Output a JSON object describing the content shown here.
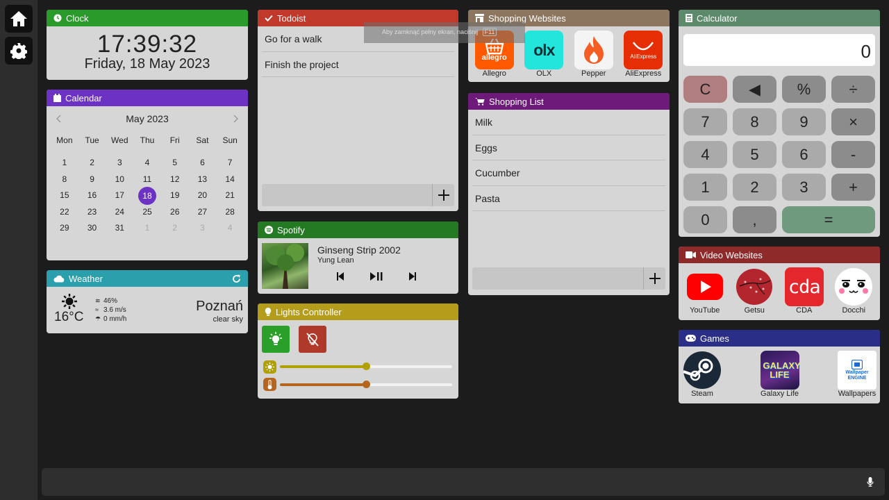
{
  "clock": {
    "title": "Clock",
    "time": "17:39:32",
    "date": "Friday, 18 May 2023",
    "color": "#2a9a2a"
  },
  "calendar": {
    "title": "Calendar",
    "month": "May 2023",
    "color": "#6c32c4",
    "weekdays": [
      "Mon",
      "Tue",
      "Wed",
      "Thu",
      "Fri",
      "Sat",
      "Sun"
    ],
    "days": [
      {
        "d": "1"
      },
      {
        "d": "2"
      },
      {
        "d": "3"
      },
      {
        "d": "4"
      },
      {
        "d": "5"
      },
      {
        "d": "6"
      },
      {
        "d": "7"
      },
      {
        "d": "8"
      },
      {
        "d": "9"
      },
      {
        "d": "10"
      },
      {
        "d": "11"
      },
      {
        "d": "12"
      },
      {
        "d": "13"
      },
      {
        "d": "14"
      },
      {
        "d": "15"
      },
      {
        "d": "16"
      },
      {
        "d": "17"
      },
      {
        "d": "18",
        "selected": true
      },
      {
        "d": "19"
      },
      {
        "d": "20"
      },
      {
        "d": "21"
      },
      {
        "d": "22"
      },
      {
        "d": "23"
      },
      {
        "d": "24"
      },
      {
        "d": "25"
      },
      {
        "d": "26"
      },
      {
        "d": "27"
      },
      {
        "d": "28"
      },
      {
        "d": "29"
      },
      {
        "d": "30"
      },
      {
        "d": "31"
      },
      {
        "d": "1",
        "other": true
      },
      {
        "d": "2",
        "other": true
      },
      {
        "d": "3",
        "other": true
      },
      {
        "d": "4",
        "other": true
      }
    ]
  },
  "weather": {
    "title": "Weather",
    "temp": "16°C",
    "humidity": "46%",
    "wind": "3.6 m/s",
    "rain": "0 mm/h",
    "city": "Poznań",
    "desc": "clear sky",
    "color": "#2b9fab"
  },
  "todoist": {
    "title": "Todoist",
    "color": "#c0392b",
    "items": [
      "Go for a walk",
      "Finish the project"
    ]
  },
  "spotify": {
    "title": "Spotify",
    "color": "#237a23",
    "track": "Ginseng Strip 2002",
    "artist": "Yung Lean"
  },
  "lights": {
    "title": "Lights Controller",
    "color": "#b59d1c",
    "brightness": 0.5,
    "temperature": 0.5,
    "brightness_color": "#b0a000",
    "temperature_color": "#b5651d"
  },
  "shopping_websites": {
    "title": "Shopping Websites",
    "color": "#8c7660",
    "items": [
      {
        "label": "Allegro",
        "logo": "allegro"
      },
      {
        "label": "OLX",
        "logo": "olx"
      },
      {
        "label": "Pepper",
        "logo": ""
      },
      {
        "label": "AliExpress",
        "logo": "AliExpress"
      }
    ]
  },
  "shopping_list": {
    "title": "Shopping List",
    "color": "#6e1a7a",
    "items": [
      "Milk",
      "Eggs",
      "Cucumber",
      "Pasta"
    ]
  },
  "calculator": {
    "title": "Calculator",
    "color": "#5e8a6c",
    "display": "0",
    "keys": [
      {
        "k": "C",
        "t": "clear"
      },
      {
        "k": "◀",
        "t": "op"
      },
      {
        "k": "%",
        "t": "op"
      },
      {
        "k": "÷",
        "t": "op"
      },
      {
        "k": "7",
        "t": "num"
      },
      {
        "k": "8",
        "t": "num"
      },
      {
        "k": "9",
        "t": "num"
      },
      {
        "k": "×",
        "t": "op"
      },
      {
        "k": "4",
        "t": "num"
      },
      {
        "k": "5",
        "t": "num"
      },
      {
        "k": "6",
        "t": "num"
      },
      {
        "k": "-",
        "t": "op"
      },
      {
        "k": "1",
        "t": "num"
      },
      {
        "k": "2",
        "t": "num"
      },
      {
        "k": "3",
        "t": "num"
      },
      {
        "k": "+",
        "t": "op"
      },
      {
        "k": "0",
        "t": "num"
      },
      {
        "k": ",",
        "t": "op"
      },
      {
        "k": "=",
        "t": "eq"
      }
    ]
  },
  "video_websites": {
    "title": "Video Websites",
    "color": "#8e2a2a",
    "items": [
      {
        "label": "YouTube",
        "logo": ""
      },
      {
        "label": "Getsu",
        "logo": ""
      },
      {
        "label": "CDA",
        "logo": "cda"
      },
      {
        "label": "Docchi",
        "logo": ""
      }
    ]
  },
  "games": {
    "title": "Games",
    "color": "#2a2e86",
    "items": [
      {
        "label": "Steam",
        "logo": ""
      },
      {
        "label": "Galaxy Life",
        "logo": "GALAXY LIFE"
      },
      {
        "label": "Wallpapers",
        "logo": "Wallpaper ENGINE"
      }
    ]
  },
  "toast": {
    "text": "Aby zamknąć pełny ekran, naciśnij",
    "key": "F11"
  }
}
